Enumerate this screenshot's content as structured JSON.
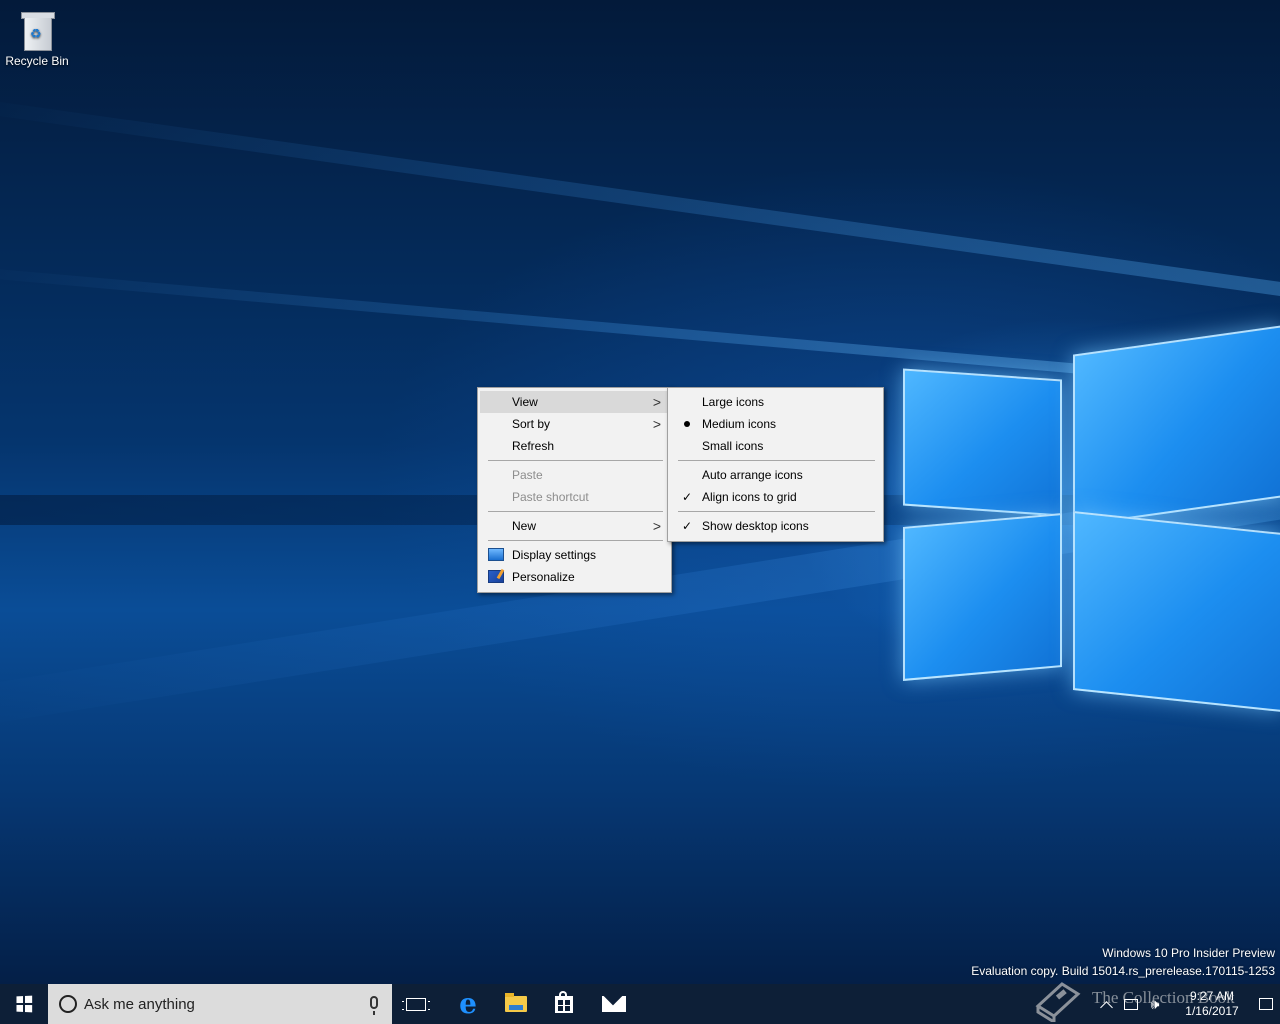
{
  "desktop": {
    "icons": [
      {
        "label": "Recycle Bin",
        "icon": "recycle-bin-icon"
      }
    ],
    "watermark": {
      "line1": "Windows 10 Pro Insider Preview",
      "line2": "Evaluation copy. Build 15014.rs_prerelease.170115-1253"
    },
    "overlay_text": "The Collection Book"
  },
  "context_menu": {
    "items": [
      {
        "label": "View",
        "submenu": true,
        "highlighted": true
      },
      {
        "label": "Sort by",
        "submenu": true
      },
      {
        "label": "Refresh"
      },
      {
        "label": "Paste",
        "disabled": true
      },
      {
        "label": "Paste shortcut",
        "disabled": true
      },
      {
        "label": "New",
        "submenu": true
      },
      {
        "label": "Display settings",
        "icon": "display-settings-icon"
      },
      {
        "label": "Personalize",
        "icon": "personalize-icon"
      }
    ],
    "submenu_arrow": ">"
  },
  "view_submenu": {
    "items": [
      {
        "label": "Large icons"
      },
      {
        "label": "Medium icons",
        "mark": "bullet"
      },
      {
        "label": "Small icons"
      },
      {
        "label": "Auto arrange icons"
      },
      {
        "label": "Align icons to grid",
        "mark": "check"
      },
      {
        "label": "Show desktop icons",
        "mark": "check"
      }
    ],
    "check_glyph": "✓"
  },
  "taskbar": {
    "search": {
      "placeholder": "Ask me anything"
    },
    "pinned": [
      {
        "name": "Task View",
        "icon": "task-view-icon"
      },
      {
        "name": "Microsoft Edge",
        "icon": "edge-icon"
      },
      {
        "name": "File Explorer",
        "icon": "file-explorer-icon"
      },
      {
        "name": "Store",
        "icon": "store-icon"
      },
      {
        "name": "Mail",
        "icon": "mail-icon"
      }
    ],
    "tray": {
      "time": "9:27 AM",
      "date": "1/16/2017",
      "volume_glyph": "🕪"
    }
  },
  "colors": {
    "taskbar": "#0d1f37",
    "menu_bg": "#f2f2f2",
    "menu_highlight": "#d9d9d9",
    "accent": "#1e90ff"
  }
}
